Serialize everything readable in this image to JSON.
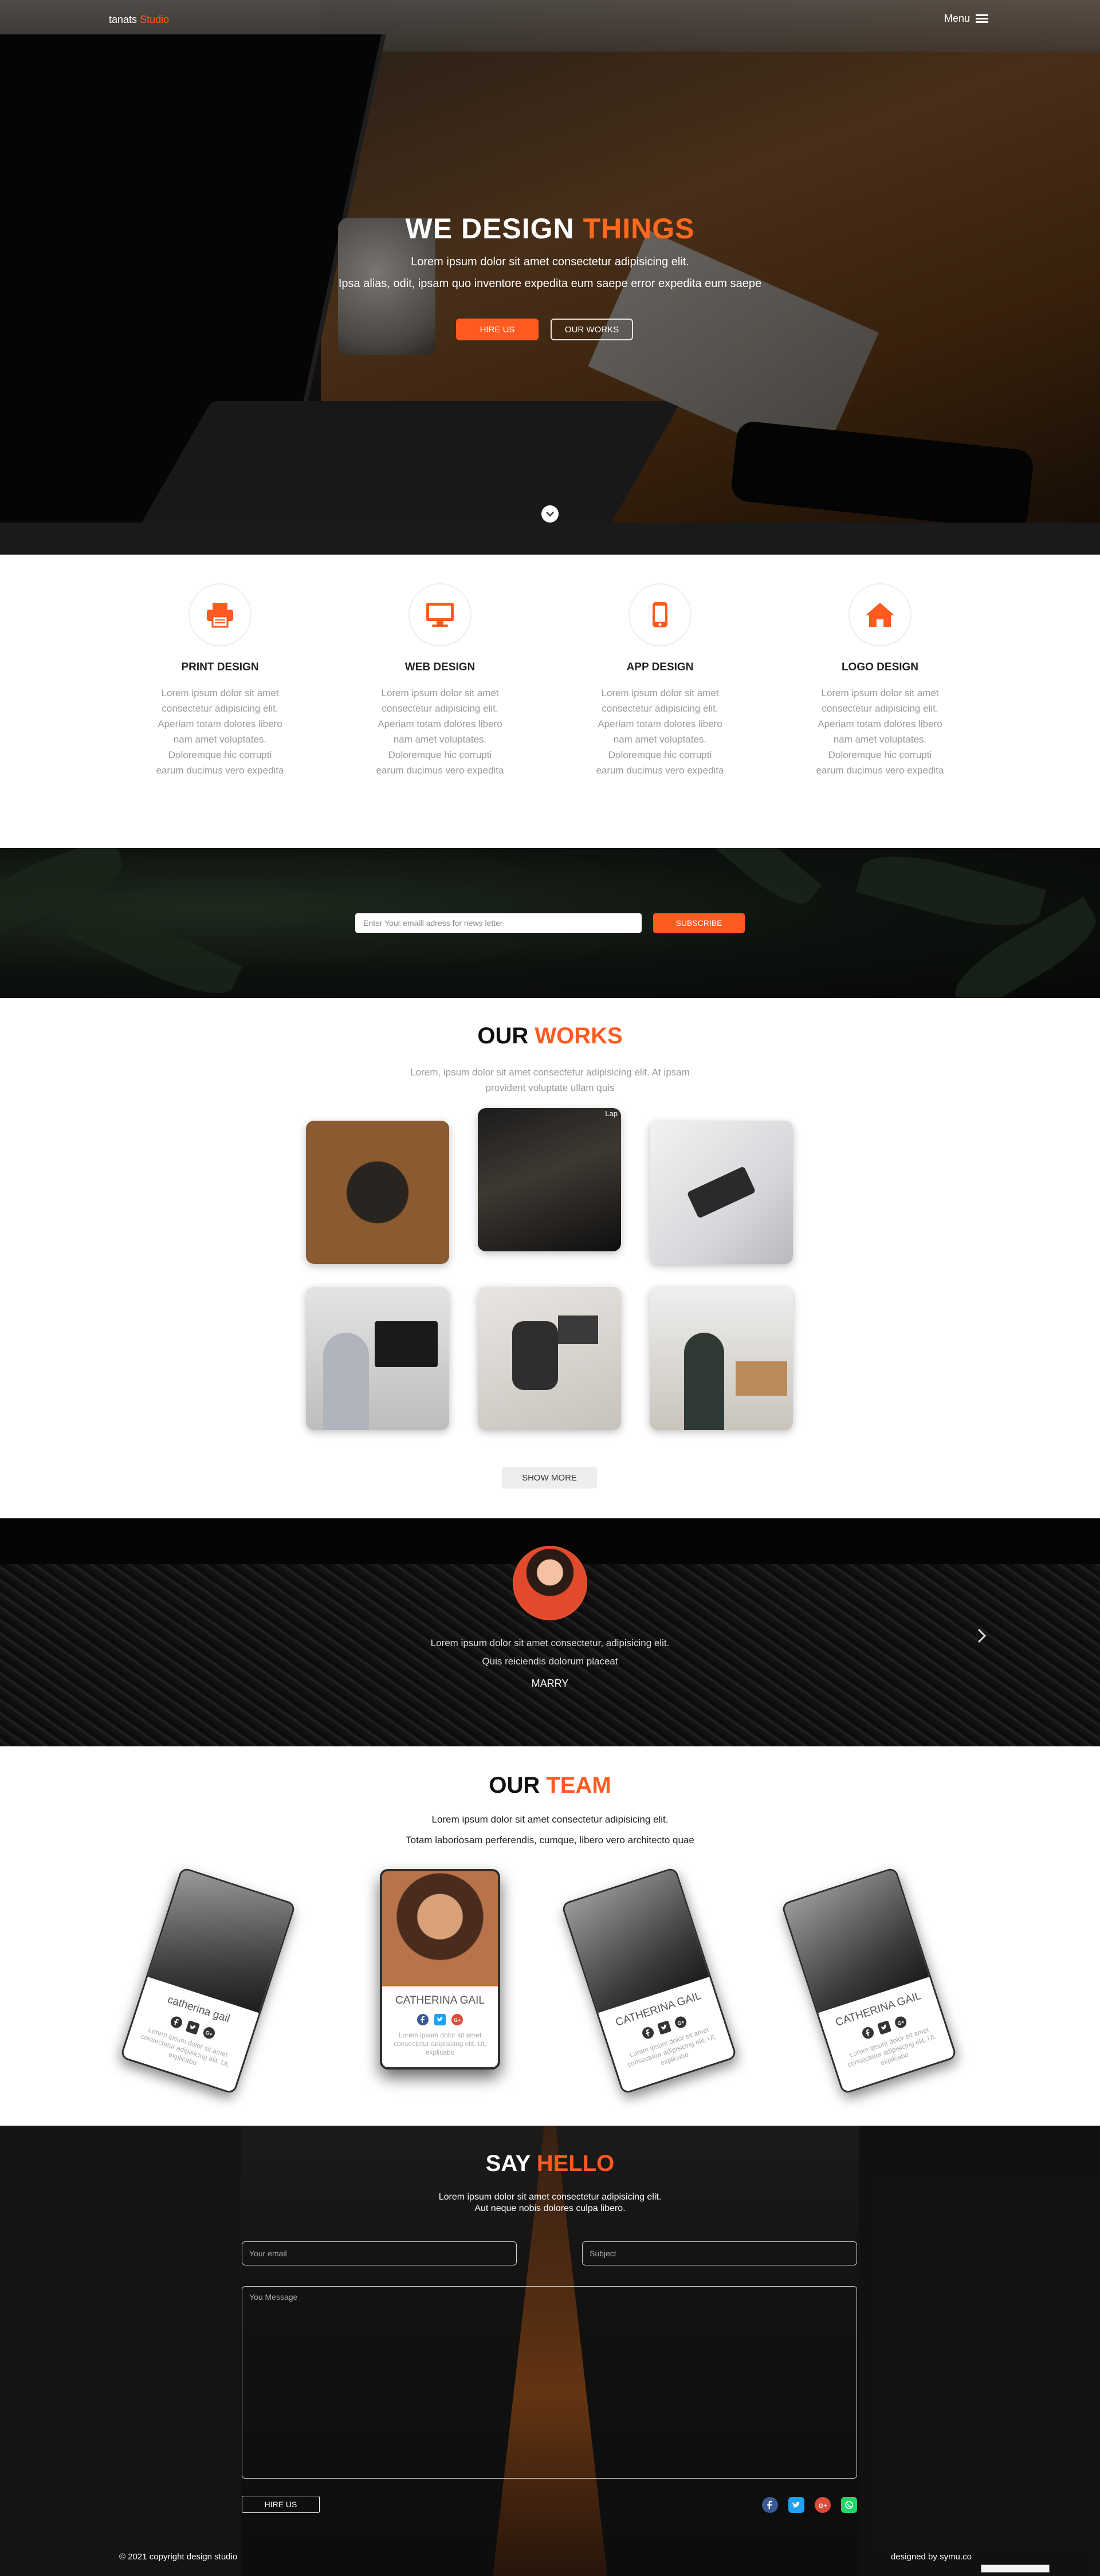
{
  "brand": {
    "name_part1": "tanats",
    "name_part2": "Studio"
  },
  "header": {
    "menu_label": "Menu"
  },
  "hero": {
    "title_part1": "WE DESIGN",
    "title_part2": "THINGS",
    "subtitle_line1": "Lorem ipsum dolor sit amet consectetur adipisicing elit.",
    "subtitle_line2": "Ipsa alias, odit, ipsam quo inventore expedita eum saepe error expedita eum saepe",
    "primary_button": "HIRE US",
    "secondary_button": "OUR WORKS"
  },
  "services": [
    {
      "icon": "printer-icon",
      "title": "PRINT DESIGN",
      "text": "Lorem ipsum dolor sit amet consectetur adipisicing elit. Aperiam totam dolores libero nam amet voluptates. Doloremque hic corrupti earum ducimus vero expedita"
    },
    {
      "icon": "desktop-icon",
      "title": "WEB DESIGN",
      "text": "Lorem ipsum dolor sit amet consectetur adipisicing elit. Aperiam totam dolores libero nam amet voluptates. Doloremque hic corrupti earum ducimus vero expedita"
    },
    {
      "icon": "mobile-icon",
      "title": "APP DESIGN",
      "text": "Lorem ipsum dolor sit amet consectetur adipisicing elit. Aperiam totam dolores libero nam amet voluptates. Doloremque hic corrupti earum ducimus vero expedita"
    },
    {
      "icon": "home-icon",
      "title": "LOGO DESIGN",
      "text": "Lorem ipsum dolor sit amet consectetur adipisicing elit. Aperiam totam dolores libero nam amet voluptates. Doloremque hic corrupti earum ducimus vero expedita"
    }
  ],
  "newsletter": {
    "placeholder": "Enter Your emaill adress for news letter",
    "button": "SUBSCRIBE"
  },
  "works": {
    "title_part1": "OUR",
    "title_part2": "WORKS",
    "subtitle": "Lorem, ipsum dolor sit amet consectetur adipisicing elit. At ipsam provident voluptate ullam quis",
    "hover_label": "Lap",
    "show_more": "SHOW MORE"
  },
  "testimonial": {
    "quote_line1": "Lorem ipsum dolor sit amet consectetur, adipisicing elit.",
    "quote_line2": "Quis reiciendis dolorum placeat",
    "author": "MARRY"
  },
  "team": {
    "title_part1": "OUR",
    "title_part2": "TEAM",
    "subtitle_line1": "Lorem ipsum dolor sit amet consectetur adipisicing elit.",
    "subtitle_line2": "Totam laboriosam perferendis, cumque, libero vero architecto quae",
    "members": [
      {
        "name": "catherina gail",
        "text": "Lorem ipsum dolor sit amet consectetur adipisicing elit. Ut, explicabo"
      },
      {
        "name": "CATHERINA GAIL",
        "text": "Lorem ipsum dolor sit amet consectetur adipisicing elit. Ut, explicabo"
      },
      {
        "name": "CATHERINA GAIL",
        "text": "Lorem ipsum dolor sit amet consectetur adipisicing elit. Ut, explicabo"
      },
      {
        "name": "CATHERINA GAIL",
        "text": "Lorem ipsum dolor sit amet consectetur adipisicing elit. Ut, explicabo"
      }
    ]
  },
  "contact": {
    "title_part1": "SAY",
    "title_part2": "HELLO",
    "subtitle_line1": "Lorem ipsum dolor sit amet consectetur adipisicing elit.",
    "subtitle_line2": "Aut neque nobis dolores culpa libero.",
    "email_placeholder": "Your email",
    "subject_placeholder": "Subject",
    "message_placeholder": "You Message",
    "button": "HIRE US"
  },
  "footer": {
    "copyright": "© 2021 copyright design studio",
    "credit": "designed by symu.co"
  },
  "colors": {
    "accent": "#ff5a1f",
    "facebook": "#3b5998",
    "twitter": "#1da1f2",
    "google_plus": "#dd4b39",
    "whatsapp": "#25d366"
  }
}
